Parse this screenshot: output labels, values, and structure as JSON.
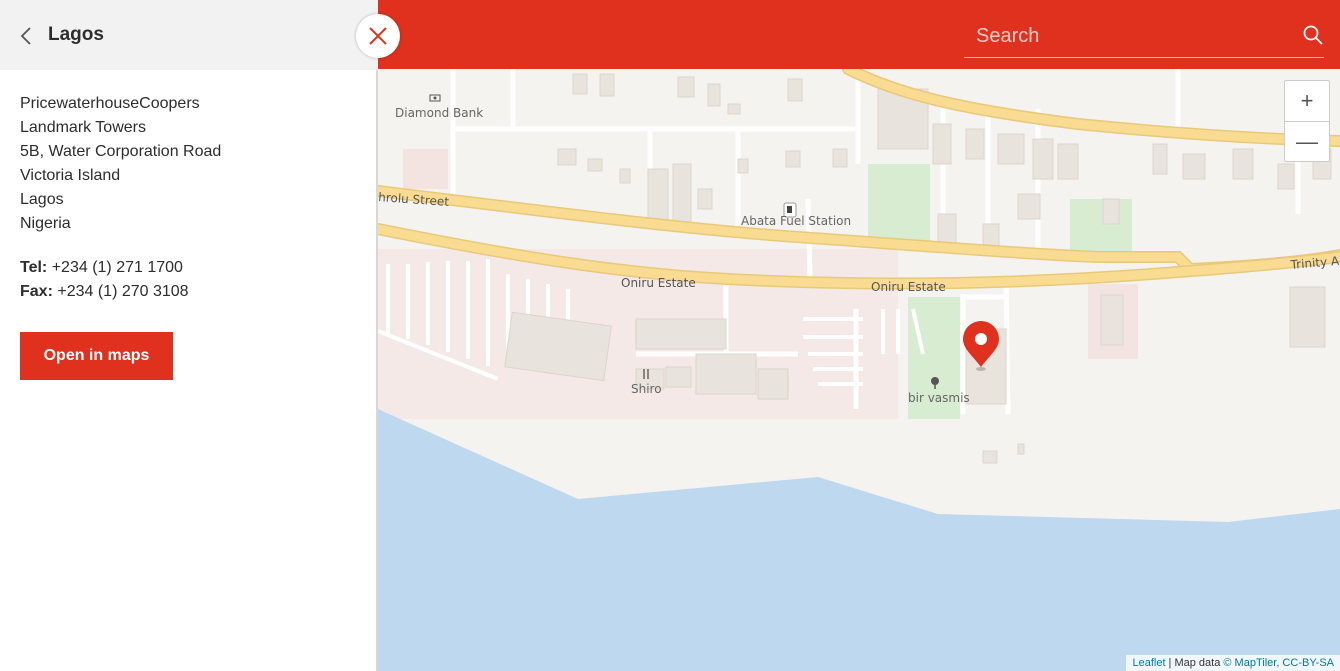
{
  "sidebar": {
    "title": "Lagos",
    "address": [
      "PricewaterhouseCoopers",
      "Landmark Towers",
      "5B, Water Corporation Road",
      "Victoria Island",
      "Lagos",
      "Nigeria"
    ],
    "tel_label": "Tel:",
    "tel_value": " +234 (1) 271 1700",
    "fax_label": "Fax:",
    "fax_value": " +234 (1) 270 3108",
    "open_button": "Open in maps"
  },
  "search": {
    "placeholder": "Search"
  },
  "map": {
    "labels": {
      "diamond_bank": "Diamond Bank",
      "abata_fuel": "Abata Fuel Station",
      "street_west": "hrolu Street",
      "oniru1": "Oniru Estate",
      "oniru2": "Oniru Estate",
      "trinity": "Trinity A",
      "shiro": "Shiro",
      "bir_vasmis": "bir vasmis"
    },
    "zoom_in": "+",
    "zoom_out": "—",
    "attribution": {
      "leaflet": "Leaflet",
      "sep": " | Map data ",
      "maptiler": "© MapTiler, CC-BY-SA"
    }
  },
  "colors": {
    "accent": "#e0301e",
    "water": "#bed8f0",
    "road": "#f9dc92",
    "park": "#d8ecd1"
  }
}
